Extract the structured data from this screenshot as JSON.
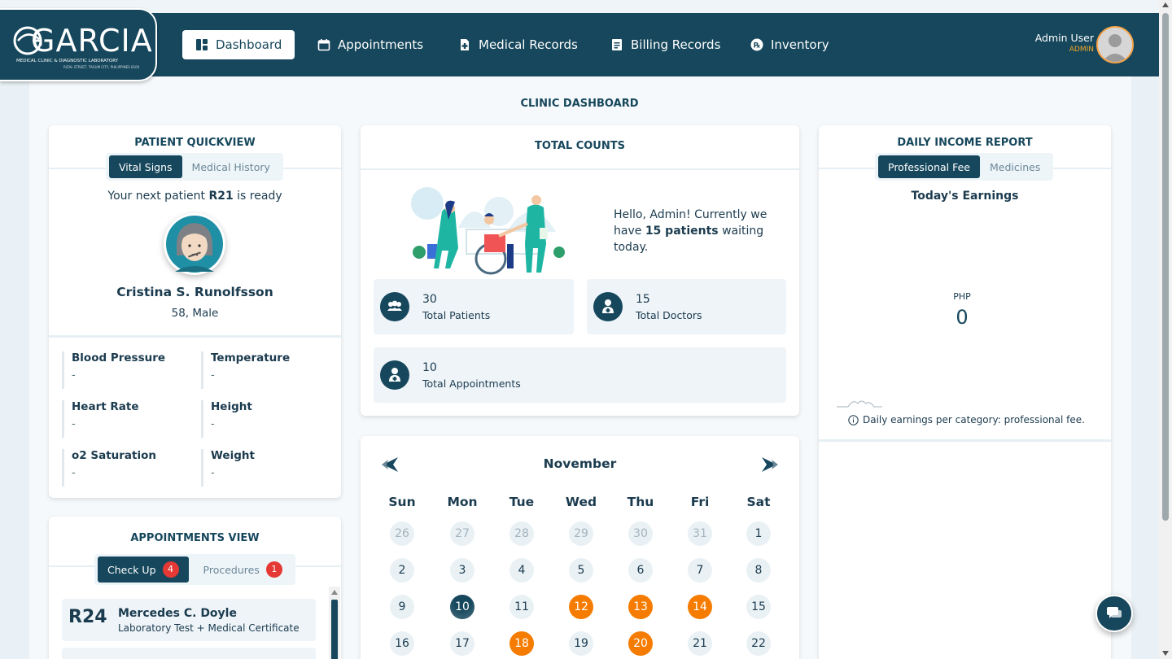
{
  "brand": {
    "name": "GARCIA",
    "subtitle": "MEDICAL CLINIC & DIAGNOSTIC LABORATORY",
    "address": "RIZAL STREET, TAGUM CITY, PHILIPPINES 8100"
  },
  "nav": {
    "dashboard": "Dashboard",
    "appointments": "Appointments",
    "medical_records": "Medical Records",
    "billing_records": "Billing Records",
    "inventory": "Inventory"
  },
  "user": {
    "name": "Admin User",
    "role": "ADMIN"
  },
  "page": {
    "title": "CLINIC DASHBOARD"
  },
  "quickview": {
    "title": "PATIENT QUICKVIEW",
    "tabs": [
      "Vital Signs",
      "Medical History"
    ],
    "next_prefix": "Your next patient ",
    "next_id": "R21",
    "next_suffix": " is ready",
    "patient_name": "Cristina S. Runolfsson",
    "patient_info": "58, Male",
    "vitals": [
      {
        "label": "Blood Pressure",
        "value": "-"
      },
      {
        "label": "Temperature",
        "value": "-"
      },
      {
        "label": "Heart Rate",
        "value": "-"
      },
      {
        "label": "Height",
        "value": "-"
      },
      {
        "label": "o2 Saturation",
        "value": "-"
      },
      {
        "label": "Weight",
        "value": "-"
      }
    ]
  },
  "appointments_view": {
    "title": "APPOINTMENTS VIEW",
    "tabs": [
      {
        "label": "Check Up",
        "count": "4"
      },
      {
        "label": "Procedures",
        "count": "1"
      }
    ],
    "items": [
      {
        "id": "R24",
        "name": "Mercedes C. Doyle",
        "detail": "Laboratory Test + Medical Certificate"
      }
    ]
  },
  "totals": {
    "title": "TOTAL COUNTS",
    "greeting_1": "Hello, Admin! Currently we have ",
    "greeting_bold": "15 patients",
    "greeting_2": " waiting today.",
    "stats": [
      {
        "value": "30",
        "label": "Total Patients"
      },
      {
        "value": "15",
        "label": "Total Doctors"
      },
      {
        "value": "10",
        "label": "Total Appointments"
      }
    ]
  },
  "calendar": {
    "month": "November",
    "weekdays": [
      "Sun",
      "Mon",
      "Tue",
      "Wed",
      "Thu",
      "Fri",
      "Sat"
    ],
    "rows": [
      [
        "26",
        "27",
        "28",
        "29",
        "30",
        "31",
        "1"
      ],
      [
        "2",
        "3",
        "4",
        "5",
        "6",
        "7",
        "8"
      ],
      [
        "9",
        "10",
        "11",
        "12",
        "13",
        "14",
        "15"
      ],
      [
        "16",
        "17",
        "18",
        "19",
        "20",
        "21",
        "22"
      ]
    ],
    "today": "10",
    "highlighted": [
      "12",
      "13",
      "14",
      "18",
      "20"
    ]
  },
  "income": {
    "title": "DAILY INCOME REPORT",
    "tabs": [
      "Professional Fee",
      "Medicines"
    ],
    "subtitle": "Today's Earnings",
    "currency": "PHP",
    "amount": "0",
    "note": "Daily earnings per category: professional fee."
  },
  "colors": {
    "primary": "#16475c",
    "accent": "#f57c00",
    "badge": "#e53935",
    "background": "#e9f1f6"
  }
}
